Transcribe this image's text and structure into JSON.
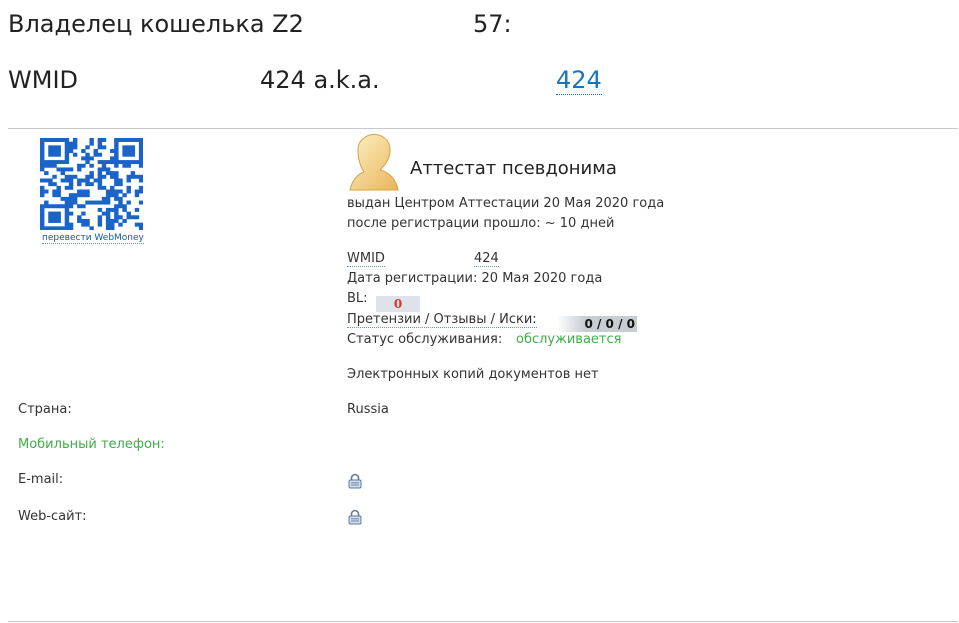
{
  "header": {
    "owner_label": "Владелец кошелька Z2",
    "owner_suffix": "57:",
    "wmid_label": "WMID",
    "wmid_aka": "424 a.k.a.",
    "wmid_link": "424"
  },
  "qr": {
    "caption": "перевести WebMoney"
  },
  "certificate": {
    "title": "Аттестат псевдонима",
    "issued": "выдан Центром Аттестации 20 Мая 2020 года",
    "since": "после регистрации прошло: ~ 10 дней"
  },
  "details": {
    "wmid_label": "WMID",
    "wmid_value": "424",
    "reg_date": "Дата регистрации: 20 Мая 2020 года",
    "bl_label": "BL:",
    "bl_value": "0",
    "claims_label": "Претензии / Отзывы / Иски:",
    "claims_value": "0 / 0 / 0",
    "status_label": "Статус обслуживания:",
    "status_value": "обслуживается",
    "docs": "Электронных копий документов нет"
  },
  "info": {
    "country_label": "Страна:",
    "country_value": "Russia",
    "phone_label": "Мобильный телефон:",
    "email_label": "E-mail:",
    "website_label": "Web-сайт:"
  },
  "colors": {
    "link": "#0d5c96",
    "accent_green": "#3fae49",
    "bl_red": "#e0322b",
    "qr_blue": "#1a64c8"
  },
  "icons": {
    "avatar": "person-silhouette-icon",
    "email_lock": "lock-icon",
    "website_lock": "lock-icon"
  }
}
